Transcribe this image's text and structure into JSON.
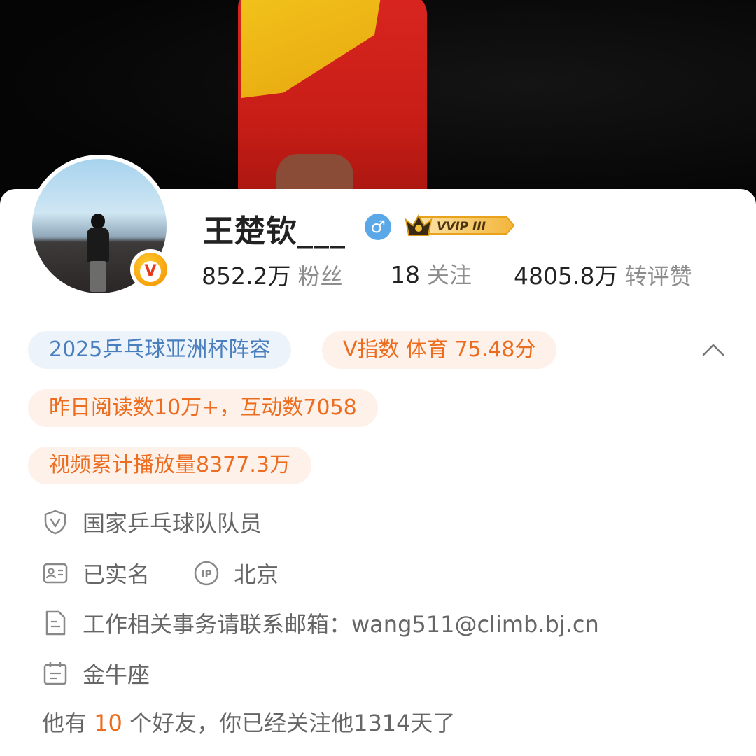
{
  "profile": {
    "name": "王楚钦___",
    "gender_icon": "male-icon",
    "vip_badge": "VVIP III",
    "verified_badge": "V",
    "stats": [
      {
        "value": "852.2万",
        "label": "粉丝"
      },
      {
        "value": "18",
        "label": "关注"
      },
      {
        "value": "4805.8万",
        "label": "转评赞"
      }
    ]
  },
  "tags": {
    "topic": "2025乒乓球亚洲杯阵容",
    "v_index": "V指数 体育 75.48分",
    "reads": "昨日阅读数10万+，互动数7058",
    "video_plays": "视频累计播放量8377.3万"
  },
  "info": {
    "verification": "国家乒乓球队队员",
    "real_name": "已实名",
    "ip_location": "北京",
    "contact": "工作相关事务请联系邮箱：wang511@climb.bj.cn",
    "zodiac": "金牛座"
  },
  "friends": {
    "prefix": "他有",
    "count": "10",
    "suffix": "个好友，你已经关注他1314天了"
  },
  "colors": {
    "accent_orange": "#ec6d1f",
    "tag_blue_text": "#4a7fbe",
    "gender_blue": "#5ba8e8",
    "badge_gold": "#f7a10c"
  }
}
